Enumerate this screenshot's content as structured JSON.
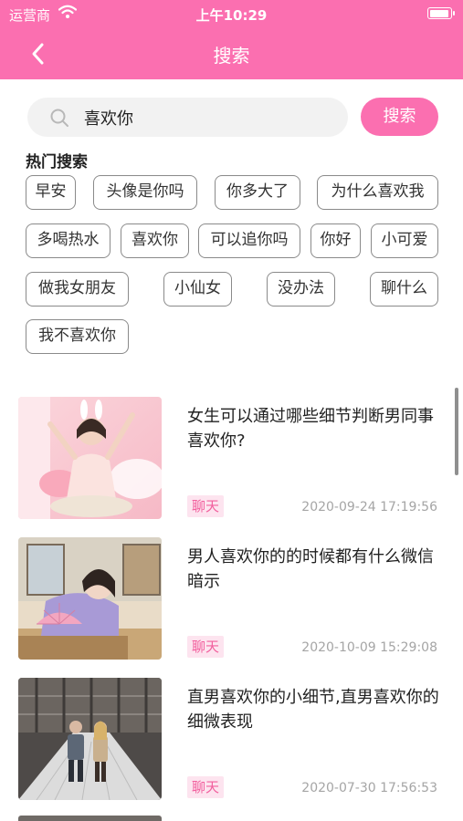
{
  "status": {
    "carrier": "运营商",
    "time": "上午10:29"
  },
  "nav": {
    "title": "搜索"
  },
  "search": {
    "value": "喜欢你",
    "button_label": "搜索"
  },
  "hot": {
    "title": "热门搜索",
    "tags": [
      "早安",
      "头像是你吗",
      "你多大了",
      "为什么喜欢我",
      "多喝热水",
      "喜欢你",
      "可以追你吗",
      "你好",
      "小可爱",
      "做我女朋友",
      "小仙女",
      "没办法",
      "聊什么",
      "我不喜欢你"
    ]
  },
  "articles": [
    {
      "title": "女生可以通过哪些细节判断男同事喜欢你?",
      "tag": "聊天",
      "date": "2020-09-24 17:19:56",
      "image": "girl-bunny-ears-photo"
    },
    {
      "title": "男人喜欢你的的时候都有什么微信暗示",
      "tag": "聊天",
      "date": "2020-10-09 15:29:08",
      "image": "girl-with-fan-photo"
    },
    {
      "title": "直男喜欢你的小细节,直男喜欢你的细微表现",
      "tag": "聊天",
      "date": "2020-07-30 17:56:53",
      "image": "couple-on-bridge-photo"
    }
  ],
  "colors": {
    "accent": "#fb6fb0",
    "badge_bg": "#fde4ef",
    "badge_text": "#f2609e"
  }
}
